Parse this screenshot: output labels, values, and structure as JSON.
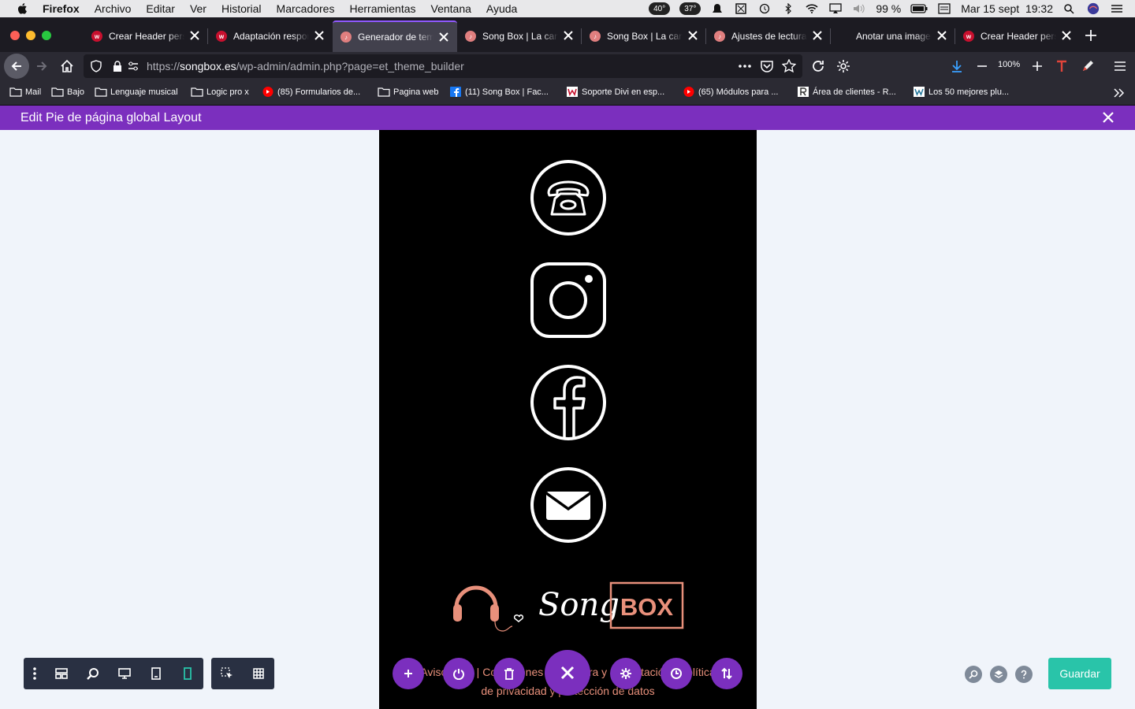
{
  "menubar": {
    "app": "Firefox",
    "items": [
      "Archivo",
      "Editar",
      "Ver",
      "Historial",
      "Marcadores",
      "Herramientas",
      "Ventana",
      "Ayuda"
    ],
    "status": {
      "temp1": "40°",
      "temp2": "37°",
      "battery": "99 %",
      "datetime": "Mar 15 sept  19:32"
    }
  },
  "tabs": [
    {
      "label": "Crear Header personalizado",
      "favicon": "w",
      "active": false
    },
    {
      "label": "Adaptación responsive",
      "favicon": "w",
      "active": false
    },
    {
      "label": "Generador de temas",
      "favicon": "s",
      "active": true
    },
    {
      "label": "Song Box | La canción",
      "favicon": "s",
      "active": false
    },
    {
      "label": "Song Box | La canción",
      "favicon": "s",
      "active": false
    },
    {
      "label": "Ajustes de lectura",
      "favicon": "s",
      "active": false
    },
    {
      "label": "Anotar una imagen",
      "favicon": "a",
      "active": false
    },
    {
      "label": "Crear Header personalizado",
      "favicon": "w",
      "active": false
    }
  ],
  "nav": {
    "url_prefix": "https://",
    "url_domain": "songbox.es",
    "url_path": "/wp-admin/admin.php?page=et_theme_builder",
    "zoom": "100%"
  },
  "bookmarks": [
    {
      "label": "Mail",
      "icon": "folder-icon"
    },
    {
      "label": "Bajo",
      "icon": "folder-icon"
    },
    {
      "label": "Lenguaje musical",
      "icon": "folder-icon"
    },
    {
      "label": "Logic pro x",
      "icon": "folder-icon"
    },
    {
      "label": "(85) Formularios de...",
      "icon": "youtube-icon"
    },
    {
      "label": "Pagina web",
      "icon": "folder-icon"
    },
    {
      "label": "(11) Song Box | Fac...",
      "icon": "facebook-icon"
    },
    {
      "label": "Soporte Divi en esp...",
      "icon": "w-icon"
    },
    {
      "label": "(65) Módulos para ...",
      "icon": "youtube-icon"
    },
    {
      "label": "Área de clientes - R...",
      "icon": "r-icon"
    },
    {
      "label": "Los 50 mejores plu...",
      "icon": "wp-icon"
    }
  ],
  "divi": {
    "title": "Edit Pie de página global Layout",
    "save_label": "Guardar"
  },
  "preview": {
    "icons": [
      "phone-icon",
      "instagram-icon",
      "facebook-icon",
      "mail-icon"
    ],
    "logo_script": "Song",
    "logo_box": "BOX",
    "footer_line1_left": "Aviso legal",
    "footer_sep": "|",
    "footer_line1_right": "Condiciones de compra y contratación | Política",
    "footer_line2": "de privacidad y protección de datos"
  },
  "colors": {
    "divi_purple": "#7b2fbe",
    "save_teal": "#29c4a9",
    "logo_salmon": "#e8907b",
    "firefox_tab_bg": "#1c1b22",
    "firefox_toolbar": "#2b2a33"
  }
}
